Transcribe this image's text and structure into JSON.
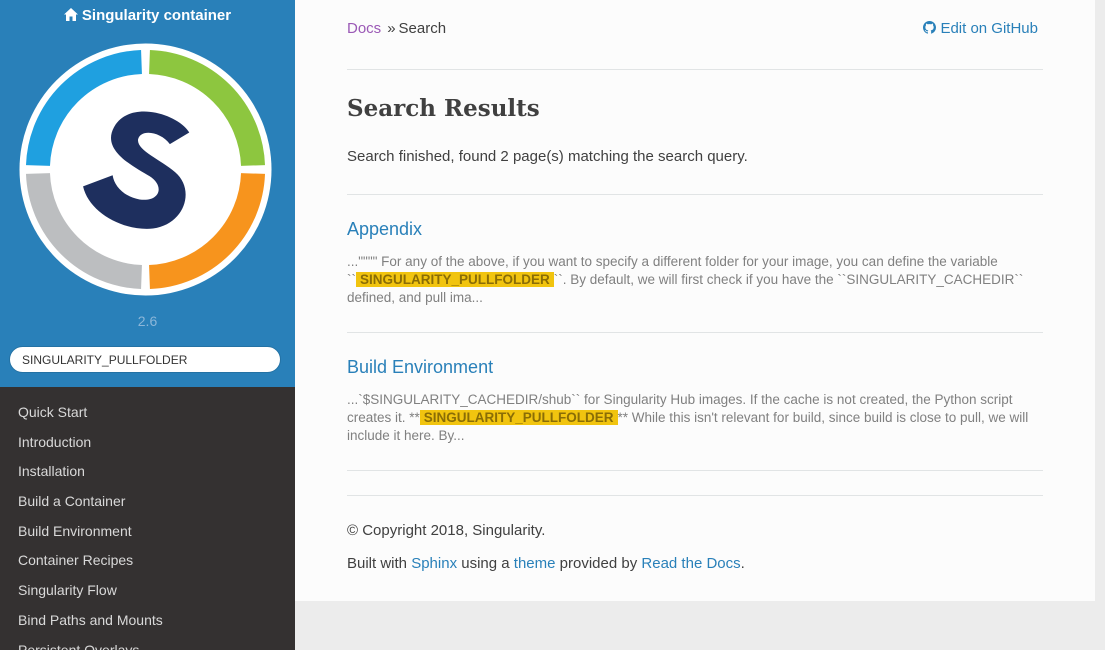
{
  "sidebar": {
    "project_name": "Singularity container",
    "version": "2.6",
    "search_value": "SINGULARITY_PULLFOLDER",
    "nav_items": [
      "Quick Start",
      "Introduction",
      "Installation",
      "Build a Container",
      "Build Environment",
      "Container Recipes",
      "Singularity Flow",
      "Bind Paths and Mounts",
      "Persistent Overlays"
    ]
  },
  "breadcrumb": {
    "docs": "Docs",
    "separator": "»",
    "current": "Search",
    "edit_link": "Edit on GitHub"
  },
  "main": {
    "title": "Search Results",
    "summary": "Search finished, found 2 page(s) matching the search query.",
    "results": [
      {
        "title": "Appendix",
        "before": "...\"\"\"\" For any of the above, if you want to specify a different folder for your image, you can define the variable ``",
        "highlight": "SINGULARITY_PULLFOLDER",
        "after": "``. By default, we will first check if you have the ``SINGULARITY_CACHEDIR`` defined, and pull ima..."
      },
      {
        "title": "Build Environment",
        "before": "...`$SINGULARITY_CACHEDIR/shub`` for Singularity Hub images. If the cache is not created, the Python script creates it. **",
        "highlight": "SINGULARITY_PULLFOLDER",
        "after": "** While this isn't relevant for build, since build is close to pull, we will include it here. By..."
      }
    ]
  },
  "footer": {
    "copyright": "© Copyright 2018, Singularity.",
    "built_with": "Built with",
    "sphinx": "Sphinx",
    "using_a": "using a",
    "theme": "theme",
    "provided_by": "provided by",
    "rtd": "Read the Docs",
    "period": "."
  },
  "colors": {
    "sidebar_top": "#2980b9",
    "sidebar_nav": "#343131",
    "link": "#2980b9",
    "visited_link": "#9b59b6",
    "highlight": "#f1c40f",
    "logo_blue": "#1fa0e0",
    "logo_green": "#8dc63f",
    "logo_orange": "#f7941d",
    "logo_gray": "#bcbec0",
    "logo_navy": "#1e2f5e"
  },
  "icons": {
    "brand": "home-icon",
    "edit": "github-icon"
  }
}
